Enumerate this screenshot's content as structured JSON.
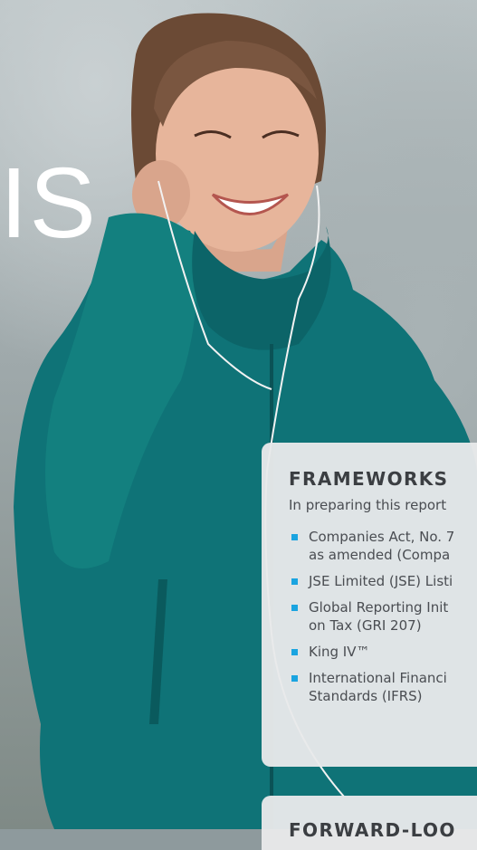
{
  "hero": {
    "big_text": "IS"
  },
  "frameworks": {
    "heading": "FRAMEWORKS",
    "intro": "In preparing this report",
    "items": [
      {
        "line1": "Companies Act, No. 7",
        "line2": "as amended (Compa"
      },
      {
        "line1": "JSE Limited (JSE) Listi",
        "line2": ""
      },
      {
        "line1": "Global Reporting Init",
        "line2": "on Tax (GRI 207)"
      },
      {
        "line1": "King IV™",
        "line2": ""
      },
      {
        "line1": "International Financi",
        "line2": "Standards (IFRS)"
      }
    ]
  },
  "next_card": {
    "heading": "FORWARD-LOO"
  },
  "colors": {
    "bullet": "#1aa4e0",
    "card_bg": "#e8e9ea",
    "jacket": "#0f7377"
  }
}
